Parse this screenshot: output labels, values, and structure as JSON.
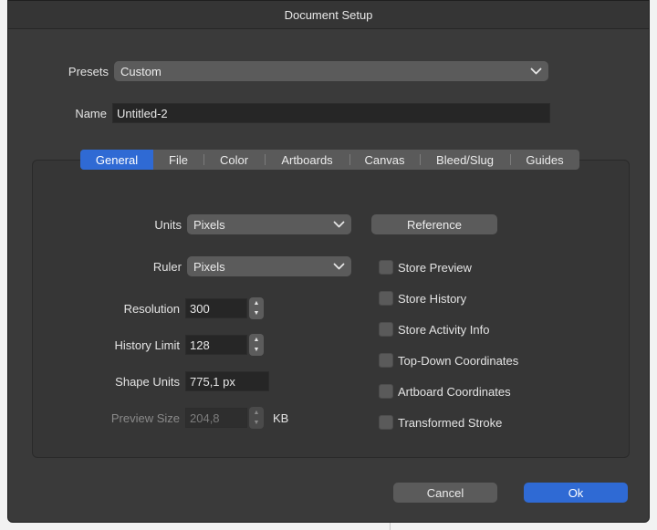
{
  "window": {
    "title": "Document Setup"
  },
  "presets": {
    "label": "Presets",
    "value": "Custom"
  },
  "name": {
    "label": "Name",
    "value": "Untitled-2"
  },
  "tabs": [
    {
      "label": "General"
    },
    {
      "label": "File"
    },
    {
      "label": "Color"
    },
    {
      "label": "Artboards"
    },
    {
      "label": "Canvas"
    },
    {
      "label": "Bleed/Slug"
    },
    {
      "label": "Guides"
    }
  ],
  "active_tab": "General",
  "general": {
    "units": {
      "label": "Units",
      "value": "Pixels"
    },
    "ruler": {
      "label": "Ruler",
      "value": "Pixels"
    },
    "resolution": {
      "label": "Resolution",
      "value": "300"
    },
    "history_limit": {
      "label": "History Limit",
      "value": "128"
    },
    "shape_units": {
      "label": "Shape Units",
      "value": "775,1 px"
    },
    "preview_size": {
      "label": "Preview Size",
      "value": "204,8",
      "unit": "KB"
    },
    "reference_button": "Reference",
    "checkboxes": [
      {
        "label": "Store Preview",
        "checked": false
      },
      {
        "label": "Store History",
        "checked": false
      },
      {
        "label": "Store Activity Info",
        "checked": false
      },
      {
        "label": "Top-Down Coordinates",
        "checked": false
      },
      {
        "label": "Artboard Coordinates",
        "checked": false
      },
      {
        "label": "Transformed Stroke",
        "checked": false
      }
    ]
  },
  "footer": {
    "cancel": "Cancel",
    "ok": "Ok"
  },
  "colors": {
    "accent": "#2f6ad4",
    "dialog_bg": "#3a3a3a",
    "control_bg": "#5b5b5b",
    "field_bg": "#262626"
  },
  "icons": {
    "dropdown": "chevron-down-icon",
    "stepper_up": "triangle-up-icon",
    "stepper_down": "triangle-down-icon"
  }
}
